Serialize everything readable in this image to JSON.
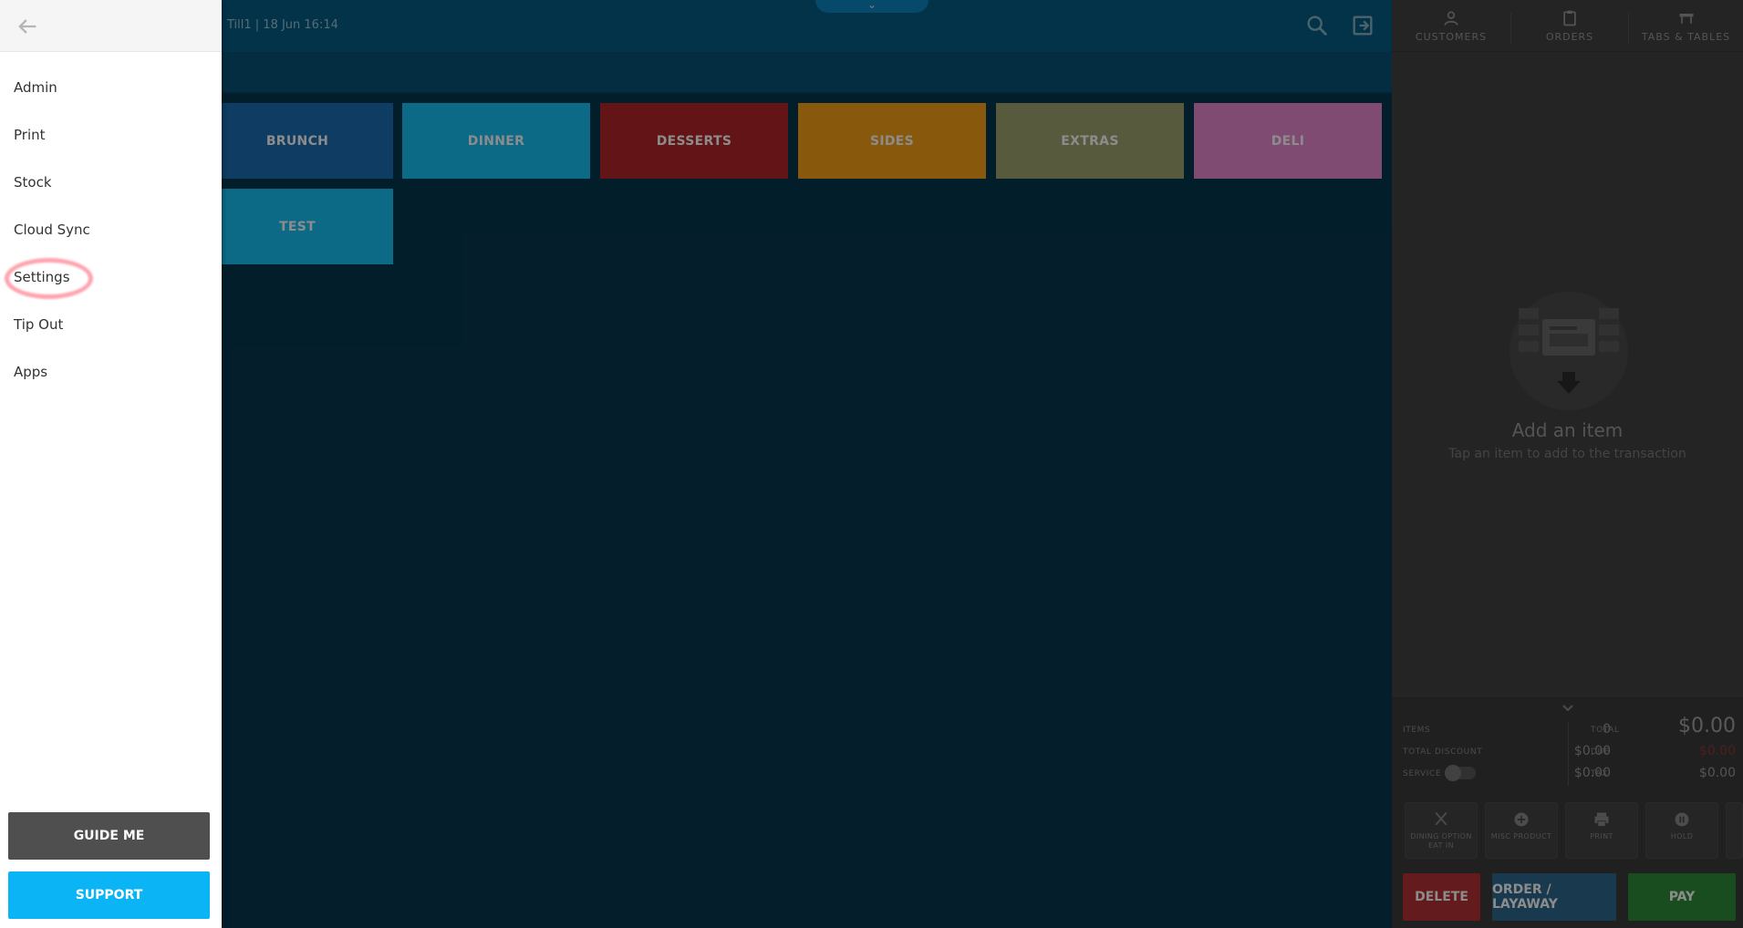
{
  "topbar": {
    "till_info": "Till1 | 18 Jun 16:14",
    "pull_tab_icon": "chevron-down-icon",
    "search_icon": "search-icon",
    "logout_icon": "logout-icon"
  },
  "categories": [
    {
      "label": "BRUNCH",
      "color": "#1a6db3",
      "text": "#ffffff"
    },
    {
      "label": "DINNER",
      "color": "#18c2f5",
      "text": "#ffffff"
    },
    {
      "label": "DESSERTS",
      "color": "#b5262a",
      "text": "#ffffff"
    },
    {
      "label": "SIDES",
      "color": "#f8a016",
      "text": "#ffffff"
    },
    {
      "label": "EXTRAS",
      "color": "#9ea56e",
      "text": "#ffffff"
    },
    {
      "label": "DELI",
      "color": "#e989d0",
      "text": "#ffffff"
    },
    {
      "label": "TEST",
      "color": "#18c2f5",
      "text": "#ffffff"
    }
  ],
  "panel": {
    "tabs": [
      {
        "label": "CUSTOMERS",
        "icon": "person-icon"
      },
      {
        "label": "ORDERS",
        "icon": "clipboard-icon"
      },
      {
        "label": "TABS & TABLES",
        "icon": "table-icon"
      }
    ],
    "empty_title": "Add an item",
    "empty_subtitle": "Tap an item to add to the transaction",
    "totals": {
      "items_label": "ITEMS",
      "items_value": "0",
      "total_discount_label": "TOTAL DISCOUNT",
      "total_discount_value": "$0.00",
      "service_label": "SERVICE",
      "service_value": "$0.00",
      "total_label": "TOTAL",
      "total_value": "$0.00",
      "due_label": "DUE",
      "due_value": "$0.00",
      "tax_label": "TAX",
      "tax_value": "$0.00"
    },
    "actions": [
      {
        "label": "DINING OPTION\nEAT IN",
        "icon": "utensils-icon"
      },
      {
        "label": "MISC PRODUCT",
        "icon": "plus-circle-icon"
      },
      {
        "label": "PRINT",
        "icon": "printer-icon"
      },
      {
        "label": "HOLD",
        "icon": "pause-circle-icon"
      }
    ],
    "delete_label": "DELETE",
    "order_label": "ORDER / LAYAWAY",
    "pay_label": "PAY",
    "colors": {
      "delete": "#b53236",
      "order": "#2e6a8e",
      "pay": "#2f8c3a",
      "due": "#c0393b"
    }
  },
  "drawer": {
    "menu": [
      "Admin",
      "Print",
      "Stock",
      "Cloud Sync",
      "Settings",
      "Tip Out",
      "Apps"
    ],
    "guide_label": "GUIDE ME",
    "support_label": "SUPPORT"
  }
}
